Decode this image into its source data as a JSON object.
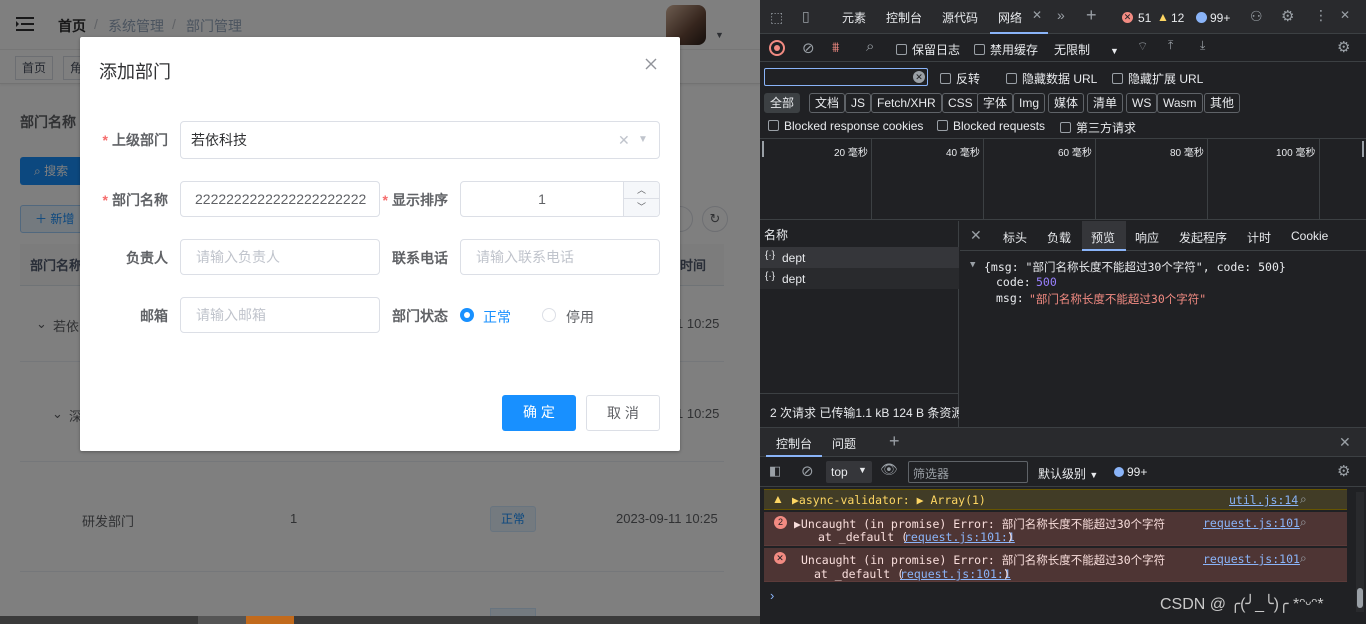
{
  "app": {
    "breadcrumb": [
      "首页",
      "系统管理",
      "部门管理"
    ],
    "breadcrumb_sep": "/",
    "tags": [
      "首页",
      "角"
    ],
    "search_label": "部门名称",
    "search_button": "搜索",
    "add_button": "新增",
    "table": {
      "headers": [
        "部门名称",
        "时间"
      ],
      "rows": [
        {
          "name": "若依",
          "time": "1 10:25"
        },
        {
          "name": "深",
          "time": "1 10:25"
        },
        {
          "name": "研发部门",
          "sort": "1",
          "status": "正常",
          "time": "2023-09-11 10:25"
        }
      ]
    }
  },
  "dialog": {
    "title": "添加部门",
    "parent_label": "上级部门",
    "parent_value": "若依科技",
    "name_label": "部门名称",
    "name_value": "2222222222222222222222",
    "sort_label": "显示排序",
    "sort_value": "1",
    "leader_label": "负责人",
    "leader_placeholder": "请输入负责人",
    "phone_label": "联系电话",
    "phone_placeholder": "请输入联系电话",
    "email_label": "邮箱",
    "email_placeholder": "请输入邮箱",
    "status_label": "部门状态",
    "status_options": [
      "正常",
      "停用"
    ],
    "status_selected": "正常",
    "confirm": "确 定",
    "cancel": "取 消",
    "required_mark": "*"
  },
  "devtools": {
    "tabs": [
      "元素",
      "控制台",
      "源代码",
      "网络"
    ],
    "active_tab": "网络",
    "errors": "51",
    "warnings": "12",
    "info": "99+",
    "toolbar": {
      "preserve_log": "保留日志",
      "disable_cache": "禁用缓存",
      "throttle": "无限制"
    },
    "filter": {
      "invert": "反转",
      "hide_data": "隐藏数据 URL",
      "hide_ext": "隐藏扩展 URL"
    },
    "types": [
      "全部",
      "文档",
      "JS",
      "Fetch/XHR",
      "CSS",
      "字体",
      "Img",
      "媒体",
      "清单",
      "WS",
      "Wasm",
      "其他"
    ],
    "blocks": [
      "Blocked response cookies",
      "Blocked requests",
      "第三方请求"
    ],
    "timeline": [
      "20 毫秒",
      "40 毫秒",
      "60 毫秒",
      "80 毫秒",
      "100 毫秒"
    ],
    "name_header": "名称",
    "requests": [
      "dept",
      "dept"
    ],
    "detail_tabs": [
      "标头",
      "负载",
      "预览",
      "响应",
      "发起程序",
      "计时",
      "Cookie"
    ],
    "detail_active": "预览",
    "preview_line": "{msg: \"部门名称长度不能超过30个字符\", code: 500}",
    "preview_code_key": "code:",
    "preview_code_val": "500",
    "preview_msg_key": "msg:",
    "preview_msg_val": "\"部门名称长度不能超过30个字符\"",
    "summary": "2 次请求  已传输1.1 kB  124 B 条资源",
    "drawer_tabs": [
      "控制台",
      "问题"
    ],
    "console_context": "top",
    "console_filter_placeholder": "筛选器",
    "console_level": "默认级别",
    "console_count": "99+",
    "messages": [
      {
        "type": "warning",
        "text": "▶async-validator:  ▶ Array(1)",
        "source": "util.js:14"
      },
      {
        "type": "error",
        "count": "2",
        "text": "▶Uncaught (in promise) Error: 部门名称长度不能超过30个字符",
        "at_text": "at _default (",
        "at_link": "request.js:101:1",
        "at_close": ")",
        "source": "request.js:101"
      },
      {
        "type": "error",
        "text": "Uncaught (in promise) Error: 部门名称长度不能超过30个字符",
        "at_text": "at _default (",
        "at_link": "request.js:101:1",
        "at_close": ")",
        "source": "request.js:101"
      }
    ],
    "watermark": "CSDN @ ╭(╯_╰)╭ *ᵔᵕᵔ*"
  },
  "colors": {
    "primary": "#1890ff",
    "dt_bg": "#202124",
    "error": "#f28b82",
    "warning": "#fdd663"
  }
}
